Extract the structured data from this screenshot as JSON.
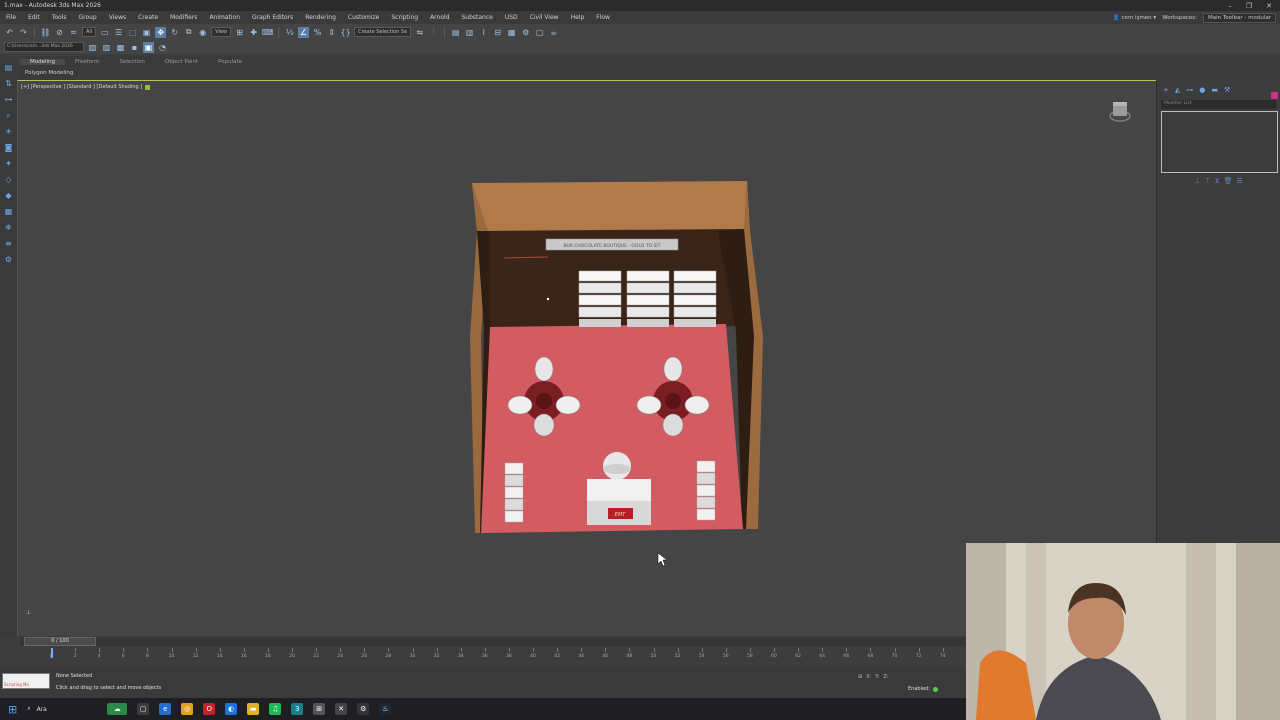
{
  "window": {
    "title": "1.max - Autodesk 3ds Max 2026",
    "controls": [
      "–",
      "❐",
      "✕"
    ]
  },
  "menu": {
    "items": [
      "File",
      "Edit",
      "Tools",
      "Group",
      "Views",
      "Create",
      "Modifiers",
      "Animation",
      "Graph Editors",
      "Rendering",
      "Customize",
      "Scripting",
      "Arnold",
      "Substance",
      "USD",
      "Civil View",
      "Help",
      "Flow"
    ],
    "user": "cem işmen",
    "workspaces_label": "Workspaces:",
    "workspace_value": "Main Toolbar - modular"
  },
  "toolbar": {
    "filter_value": "All",
    "view_value": "View",
    "selection_set": "Create Selection Se",
    "project_path": "C:\\Users\\cem...3ds Max 2026"
  },
  "ribbon": {
    "tabs": [
      "Modeling",
      "Freeform",
      "Selection",
      "Object Paint",
      "Populate"
    ],
    "sub_label": "Polygon Modeling"
  },
  "viewport": {
    "label": "[+] [Perspective ] [Standard ] [Default Shading ]",
    "banner_text": "BUK CHOCOLATE BOUTIQUE - GOLD TO SIT",
    "counter_sign": "EMT"
  },
  "command_panel": {
    "modifier_list": "Modifier List"
  },
  "timeline": {
    "slider_label": "0 / 100",
    "ticks": [
      0,
      2,
      4,
      6,
      8,
      10,
      12,
      14,
      16,
      18,
      20,
      22,
      24,
      26,
      28,
      30,
      32,
      34,
      36,
      38,
      40,
      42,
      44,
      46,
      48,
      50,
      52,
      54,
      56,
      58,
      60,
      62,
      64,
      66,
      68,
      70,
      72,
      74,
      76,
      78
    ],
    "current_frame": 0
  },
  "status": {
    "maxscript_label": "Scripting Mo",
    "selection": "None Selected",
    "hint": "Click and drag to select and move objects",
    "x_label": "X:",
    "y_label": "Y:",
    "z_label": "Z:",
    "enabled_label": "Enabled:"
  },
  "taskbar": {
    "search_label": "Ara"
  },
  "colors": {
    "accent": "#5b7fa6",
    "viewport_border": "#b9c15b",
    "floor": "#d35b62",
    "wall": "#3a2417",
    "wood": "#b07a4a",
    "enabled_dot": "#55d04a"
  }
}
